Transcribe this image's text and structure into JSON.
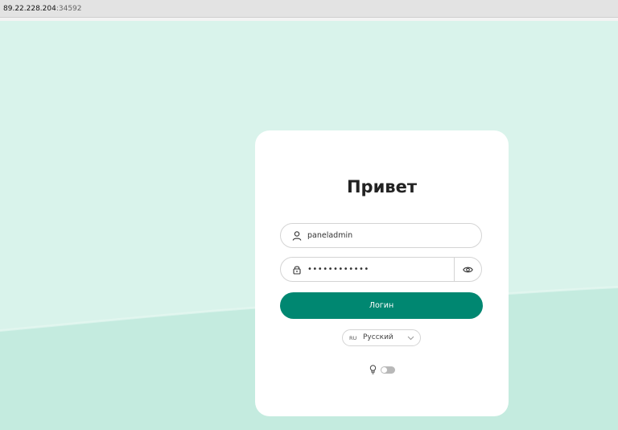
{
  "browser": {
    "host": "89.22.228.204",
    "port": ":34592"
  },
  "login": {
    "title": "Привет",
    "username_value": "paneladmin",
    "password_mask": "••••••••••••",
    "submit_label": "Логин"
  },
  "language": {
    "code": "RU",
    "name": "Русский"
  },
  "theme_toggle": {
    "on": false
  },
  "colors": {
    "accent": "#008771",
    "background": "#d9f3eb",
    "background_wave": "#c4ebdf",
    "card": "#ffffff"
  },
  "icons": [
    "user-icon",
    "lock-icon",
    "eye-icon",
    "chevron-down-icon",
    "lightbulb-icon"
  ]
}
